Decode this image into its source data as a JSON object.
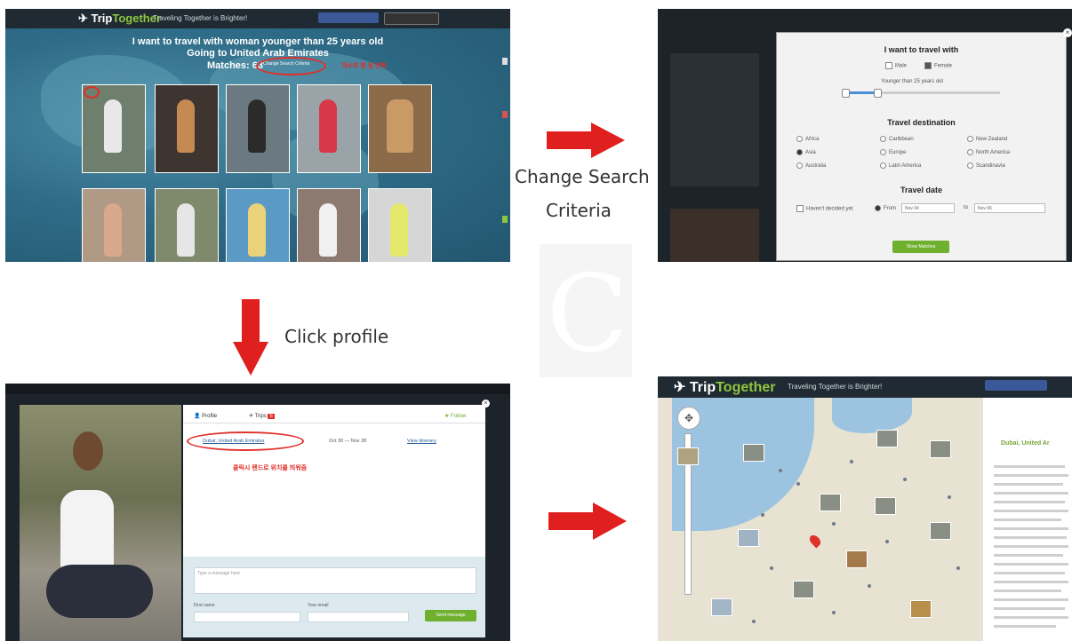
{
  "panel1": {
    "logo_a": "Trip",
    "logo_b": "Together",
    "tagline": "Traveling Together is Brighter!",
    "headline1": "I want to travel with woman younger than 25 years old",
    "headline2": "Going to United Arab Emirates",
    "headline3": "Matches: 63",
    "change_btn": "Change Search Criteria",
    "korean_note": "개수와 할 일 변화"
  },
  "panel2": {
    "title_with": "I want to travel with",
    "male": "Male",
    "female": "Female",
    "age_label": "Younger than 25 years old",
    "dest_title": "Travel destination",
    "destinations": [
      "Africa",
      "Caribbean",
      "New Zealand",
      "Asia",
      "Europe",
      "North America",
      "Australia",
      "Latin America",
      "Scandinavia"
    ],
    "date_title": "Travel date",
    "havent_decided": "Haven't decided yet",
    "from_label": "From",
    "from_value": "Nov 04",
    "to_label": "to",
    "to_value": "Nov 06",
    "show_btn": "Show Matches"
  },
  "panel3": {
    "tab_profile": "Profile",
    "tab_trips": "Trips",
    "trips_count": "5",
    "follow": "Follow",
    "destination": "Dubai, United Arab Emirates",
    "dates": "Oct 30 — Nov 28",
    "view_itinerary": "View itinerary",
    "korean_note": "클릭시 랜드로 위치를 띄워줌",
    "message_placeholder": "Type a message here",
    "first_name": "First name",
    "email": "Your email",
    "send_btn": "Send message"
  },
  "panel4": {
    "logo_a": "Trip",
    "logo_b": "Together",
    "tagline": "Traveling Together is Brighter!",
    "place_title": "Dubai, United Ar"
  },
  "captions": {
    "change_search_1": "Change Search",
    "change_search_2": "Criteria",
    "click_profile": "Click profile"
  },
  "colors": {
    "arrow": "#e0201f",
    "accent_green": "#8dc63f",
    "highlight_red": "#e0302a"
  }
}
